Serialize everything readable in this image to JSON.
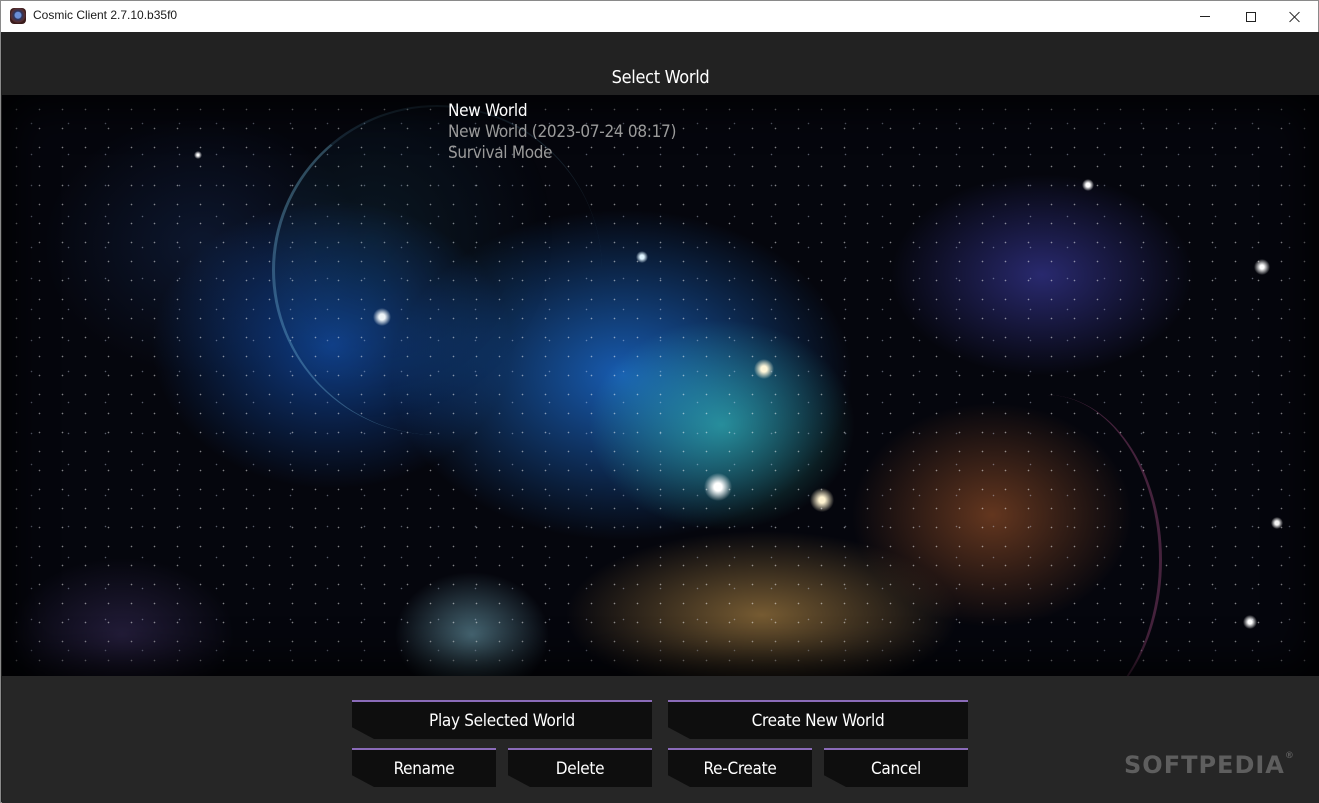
{
  "window": {
    "title": "Cosmic Client 2.7.10.b35f0",
    "icon": "cosmic-client-app-icon",
    "controls": {
      "minimize": "minimize-icon",
      "maximize": "maximize-icon",
      "close": "close-icon"
    }
  },
  "header": {
    "title": "Select World"
  },
  "worlds": [
    {
      "name": "New World",
      "detail": "New World (2023-07-24 08:17)",
      "mode": "Survival Mode"
    }
  ],
  "actions": {
    "play": "Play Selected World",
    "create": "Create New World",
    "rename": "Rename",
    "delete": "Delete",
    "recreate": "Re-Create",
    "cancel": "Cancel"
  },
  "watermark": {
    "text": "SOFTPEDIA",
    "mark": "®"
  },
  "colors": {
    "button_accent": "#8a6bb8",
    "panel_bg": "#262626",
    "button_bg": "#0e0e0e"
  }
}
